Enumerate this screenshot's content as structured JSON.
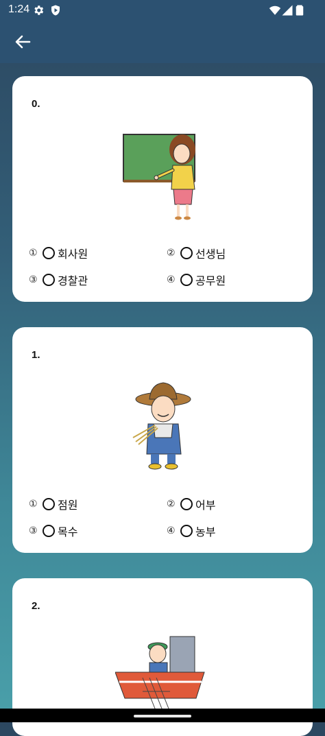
{
  "status": {
    "time": "1:24"
  },
  "questions": [
    {
      "number": "0.",
      "image": "teacher-illustration",
      "options": [
        {
          "num": "①",
          "label": "회사원"
        },
        {
          "num": "②",
          "label": "선생님"
        },
        {
          "num": "③",
          "label": "경찰관"
        },
        {
          "num": "④",
          "label": "공무원"
        }
      ]
    },
    {
      "number": "1.",
      "image": "farmer-illustration",
      "options": [
        {
          "num": "①",
          "label": "점원"
        },
        {
          "num": "②",
          "label": "어부"
        },
        {
          "num": "③",
          "label": "목수"
        },
        {
          "num": "④",
          "label": "농부"
        }
      ]
    },
    {
      "number": "2.",
      "image": "fisherman-illustration",
      "options": []
    }
  ],
  "icons": {
    "back": "arrow-left-icon",
    "settings": "gear-icon",
    "shield": "shield-icon",
    "wifi": "wifi-icon",
    "signal": "signal-icon",
    "battery": "battery-icon"
  }
}
